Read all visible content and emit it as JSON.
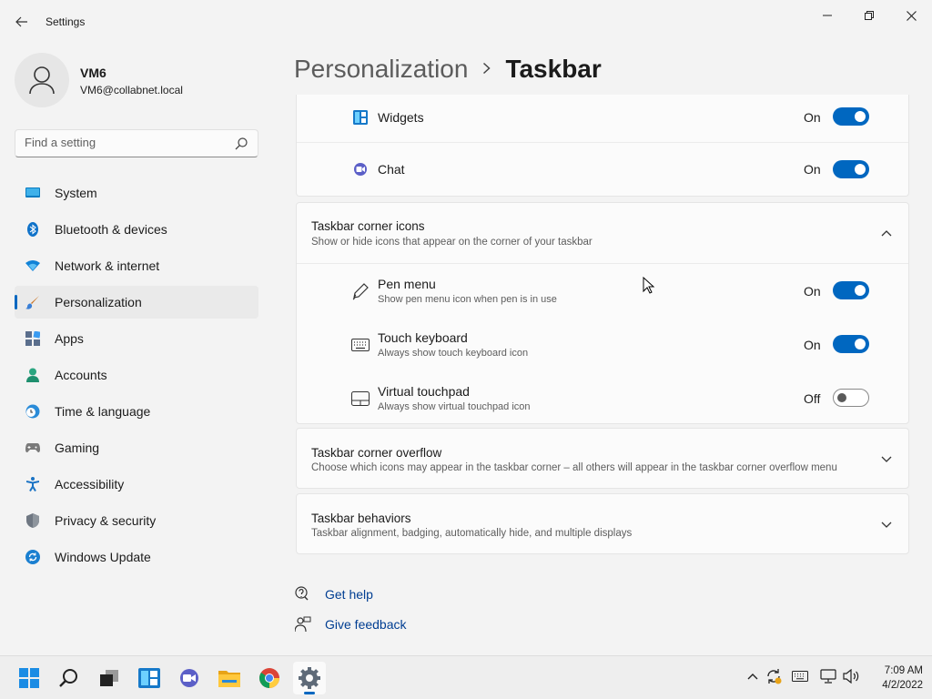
{
  "window": {
    "title": "Settings",
    "back_icon": "back-arrow-icon",
    "controls": [
      "minimize-icon",
      "maximize-icon",
      "close-icon"
    ]
  },
  "profile": {
    "name": "VM6",
    "email": "VM6@collabnet.local"
  },
  "search": {
    "placeholder": "Find a setting"
  },
  "sidebar": {
    "items": [
      {
        "label": "System",
        "icon": "monitor-icon"
      },
      {
        "label": "Bluetooth & devices",
        "icon": "bluetooth-icon"
      },
      {
        "label": "Network & internet",
        "icon": "wifi-icon"
      },
      {
        "label": "Personalization",
        "icon": "paintbrush-icon",
        "active": true
      },
      {
        "label": "Apps",
        "icon": "apps-icon"
      },
      {
        "label": "Accounts",
        "icon": "person-icon"
      },
      {
        "label": "Time & language",
        "icon": "clock-globe-icon"
      },
      {
        "label": "Gaming",
        "icon": "gamepad-icon"
      },
      {
        "label": "Accessibility",
        "icon": "accessibility-icon"
      },
      {
        "label": "Privacy & security",
        "icon": "shield-icon"
      },
      {
        "label": "Windows Update",
        "icon": "update-icon"
      }
    ]
  },
  "header": {
    "parent": "Personalization",
    "current": "Taskbar"
  },
  "taskbar_items": {
    "widgets": {
      "title": "Widgets",
      "state": "On",
      "enabled": true
    },
    "chat": {
      "title": "Chat",
      "state": "On",
      "enabled": true
    }
  },
  "corner_icons": {
    "title": "Taskbar corner icons",
    "subtitle": "Show or hide icons that appear on the corner of your taskbar",
    "items": [
      {
        "title": "Pen menu",
        "subtitle": "Show pen menu icon when pen is in use",
        "state": "On",
        "enabled": true
      },
      {
        "title": "Touch keyboard",
        "subtitle": "Always show touch keyboard icon",
        "state": "On",
        "enabled": true
      },
      {
        "title": "Virtual touchpad",
        "subtitle": "Always show virtual touchpad icon",
        "state": "Off",
        "enabled": false
      }
    ]
  },
  "corner_overflow": {
    "title": "Taskbar corner overflow",
    "subtitle": "Choose which icons may appear in the taskbar corner – all others will appear in the taskbar corner overflow menu"
  },
  "behaviors": {
    "title": "Taskbar behaviors",
    "subtitle": "Taskbar alignment, badging, automatically hide, and multiple displays"
  },
  "help": {
    "get_help": "Get help",
    "give_feedback": "Give feedback"
  },
  "taskbar": {
    "apps": [
      "start-icon",
      "search-icon",
      "task-view-icon",
      "widgets-icon",
      "chat-icon",
      "file-explorer-icon",
      "chrome-icon",
      "settings-icon"
    ],
    "tray": [
      "chevron-up-icon",
      "sync-icon",
      "keyboard-icon",
      "network-icon",
      "volume-icon"
    ],
    "time": "7:09 AM",
    "date": "4/2/2022"
  },
  "colors": {
    "accent": "#0067c0",
    "background": "#f3f3f3",
    "card": "#fbfbfb",
    "link": "#003e92"
  }
}
